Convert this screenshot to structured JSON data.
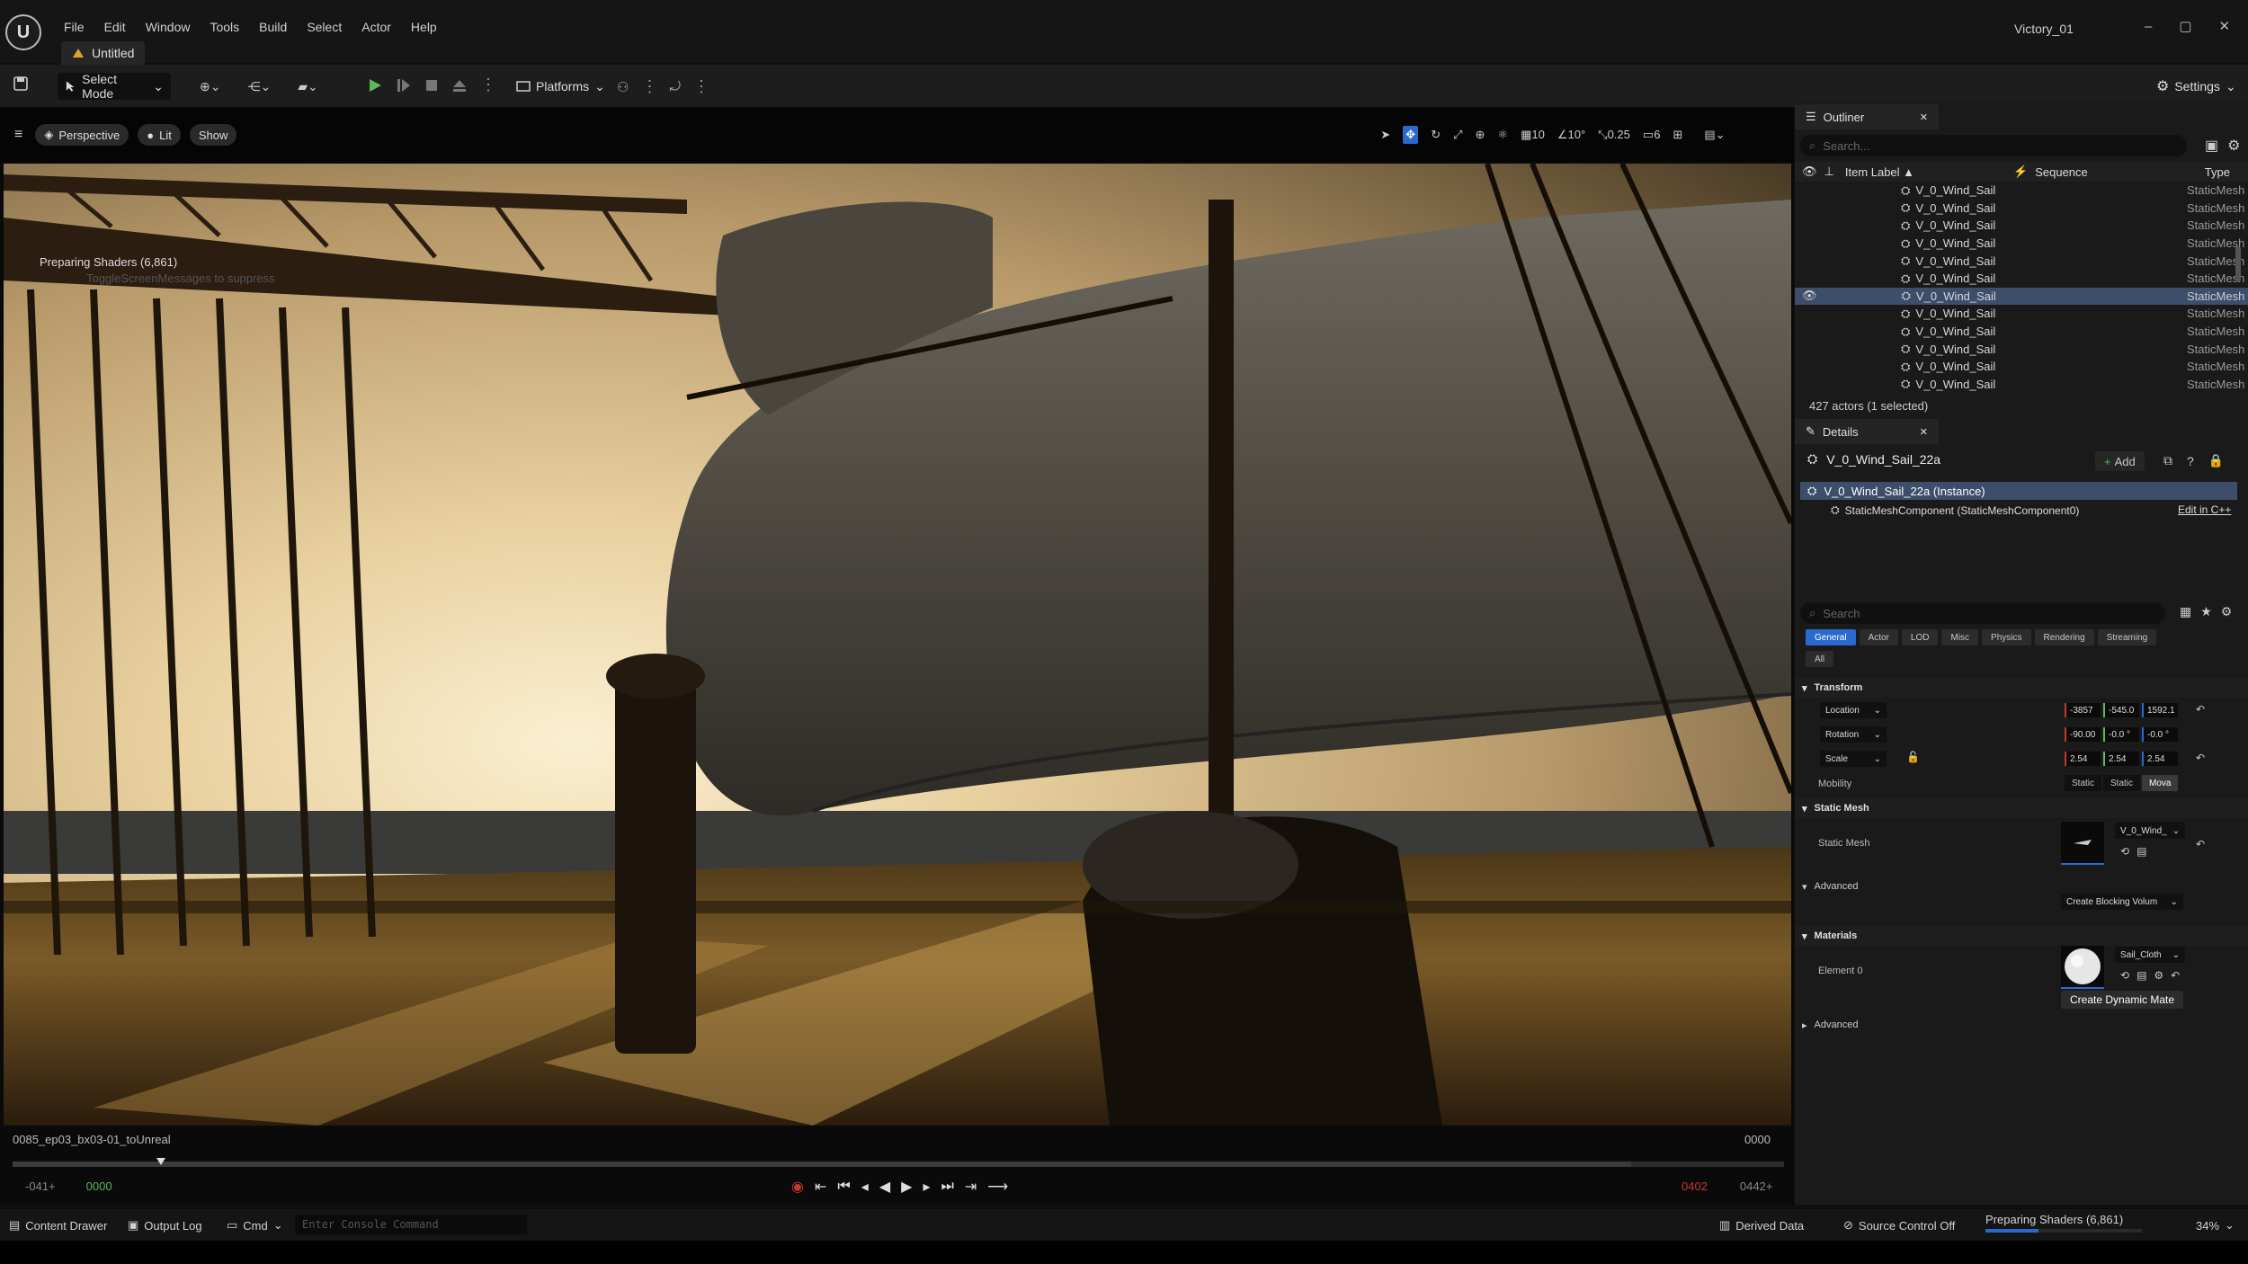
{
  "app": {
    "title": "Untitled",
    "project": "Victory_01",
    "logo_letter": "U"
  },
  "menu": [
    "File",
    "Edit",
    "Window",
    "Tools",
    "Build",
    "Select",
    "Actor",
    "Help"
  ],
  "window_controls": {
    "minimize": "–",
    "maximize": "▢",
    "close": "✕"
  },
  "toolbar": {
    "select_mode": "Select Mode",
    "platforms": "Platforms",
    "settings": "Settings"
  },
  "viewport": {
    "perspective": "Perspective",
    "lit": "Lit",
    "show": "Show",
    "grid_value": "10",
    "angle_value": "10°",
    "scale_value": "0.25",
    "camera_speed": "6",
    "overlay": "Preparing Shaders (6,861)",
    "overlay_sub": "ToggleScreenMessages to suppress",
    "sequence_name": "0085_ep03_bx03-01_toUnreal",
    "frame_right": "0000",
    "start_in": "-041+",
    "current": "0000",
    "end_out": "0402",
    "end_total": "0442+"
  },
  "outliner": {
    "tab": "Outliner",
    "search_placeholder": "Search...",
    "col_label": "Item Label ▲",
    "col_sequence": "Sequence",
    "col_type": "Type",
    "rows": [
      {
        "label": "V_0_Wind_Sail",
        "type": "StaticMesh"
      },
      {
        "label": "V_0_Wind_Sail",
        "type": "StaticMesh"
      },
      {
        "label": "V_0_Wind_Sail",
        "type": "StaticMesh"
      },
      {
        "label": "V_0_Wind_Sail",
        "type": "StaticMesh"
      },
      {
        "label": "V_0_Wind_Sail",
        "type": "StaticMesh"
      },
      {
        "label": "V_0_Wind_Sail",
        "type": "StaticMesh"
      },
      {
        "label": "V_0_Wind_Sail",
        "type": "StaticMesh",
        "selected": true
      },
      {
        "label": "V_0_Wind_Sail",
        "type": "StaticMesh"
      },
      {
        "label": "V_0_Wind_Sail",
        "type": "StaticMesh"
      },
      {
        "label": "V_0_Wind_Sail",
        "type": "StaticMesh"
      },
      {
        "label": "V_0_Wind_Sail",
        "type": "StaticMesh"
      },
      {
        "label": "V_0_Wind_Sail",
        "type": "StaticMesh"
      }
    ],
    "count": "427 actors (1 selected)"
  },
  "details": {
    "tab": "Details",
    "actor_name": "V_0_Wind_Sail_22a",
    "add_label": "Add",
    "instance": "V_0_Wind_Sail_22a (Instance)",
    "component": "StaticMeshComponent (StaticMeshComponent0)",
    "edit_cpp": "Edit in C++",
    "search_placeholder": "Search",
    "filters": [
      "General",
      "Actor",
      "LOD",
      "Misc",
      "Physics",
      "Rendering",
      "Streaming"
    ],
    "filter_all": "All",
    "transform": "Transform",
    "location": "Location",
    "rotation": "Rotation",
    "scale": "Scale",
    "loc": [
      "-3857",
      "-545.0",
      "1592.1"
    ],
    "rot": [
      "-90.00",
      "-0.0 °",
      "-0.0 °"
    ],
    "scl": [
      "2.54",
      "2.54",
      "2.54"
    ],
    "mobility": "Mobility",
    "mobility_opts": [
      "Static",
      "Static",
      "Mova"
    ],
    "static_mesh_section": "Static Mesh",
    "static_mesh_label": "Static Mesh",
    "static_mesh_value": "V_0_Wind_",
    "advanced": "Advanced",
    "blocking": "Create Blocking Volum",
    "materials": "Materials",
    "element0": "Element 0",
    "material_value": "Sail_Cloth",
    "create_dynamic": "Create Dynamic Mate",
    "advanced2": "Advanced"
  },
  "statusbar": {
    "content_drawer": "Content Drawer",
    "output_log": "Output Log",
    "cmd": "Cmd",
    "console_placeholder": "Enter Console Command",
    "derived_data": "Derived Data",
    "source_control": "Source Control Off",
    "preparing": "Preparing Shaders (6,861)",
    "percent": "34%"
  },
  "colors": {
    "accent": "#2a6acf",
    "selected_row": "#3d4e6b",
    "play": "#5cb85c",
    "record": "#c0392b"
  }
}
